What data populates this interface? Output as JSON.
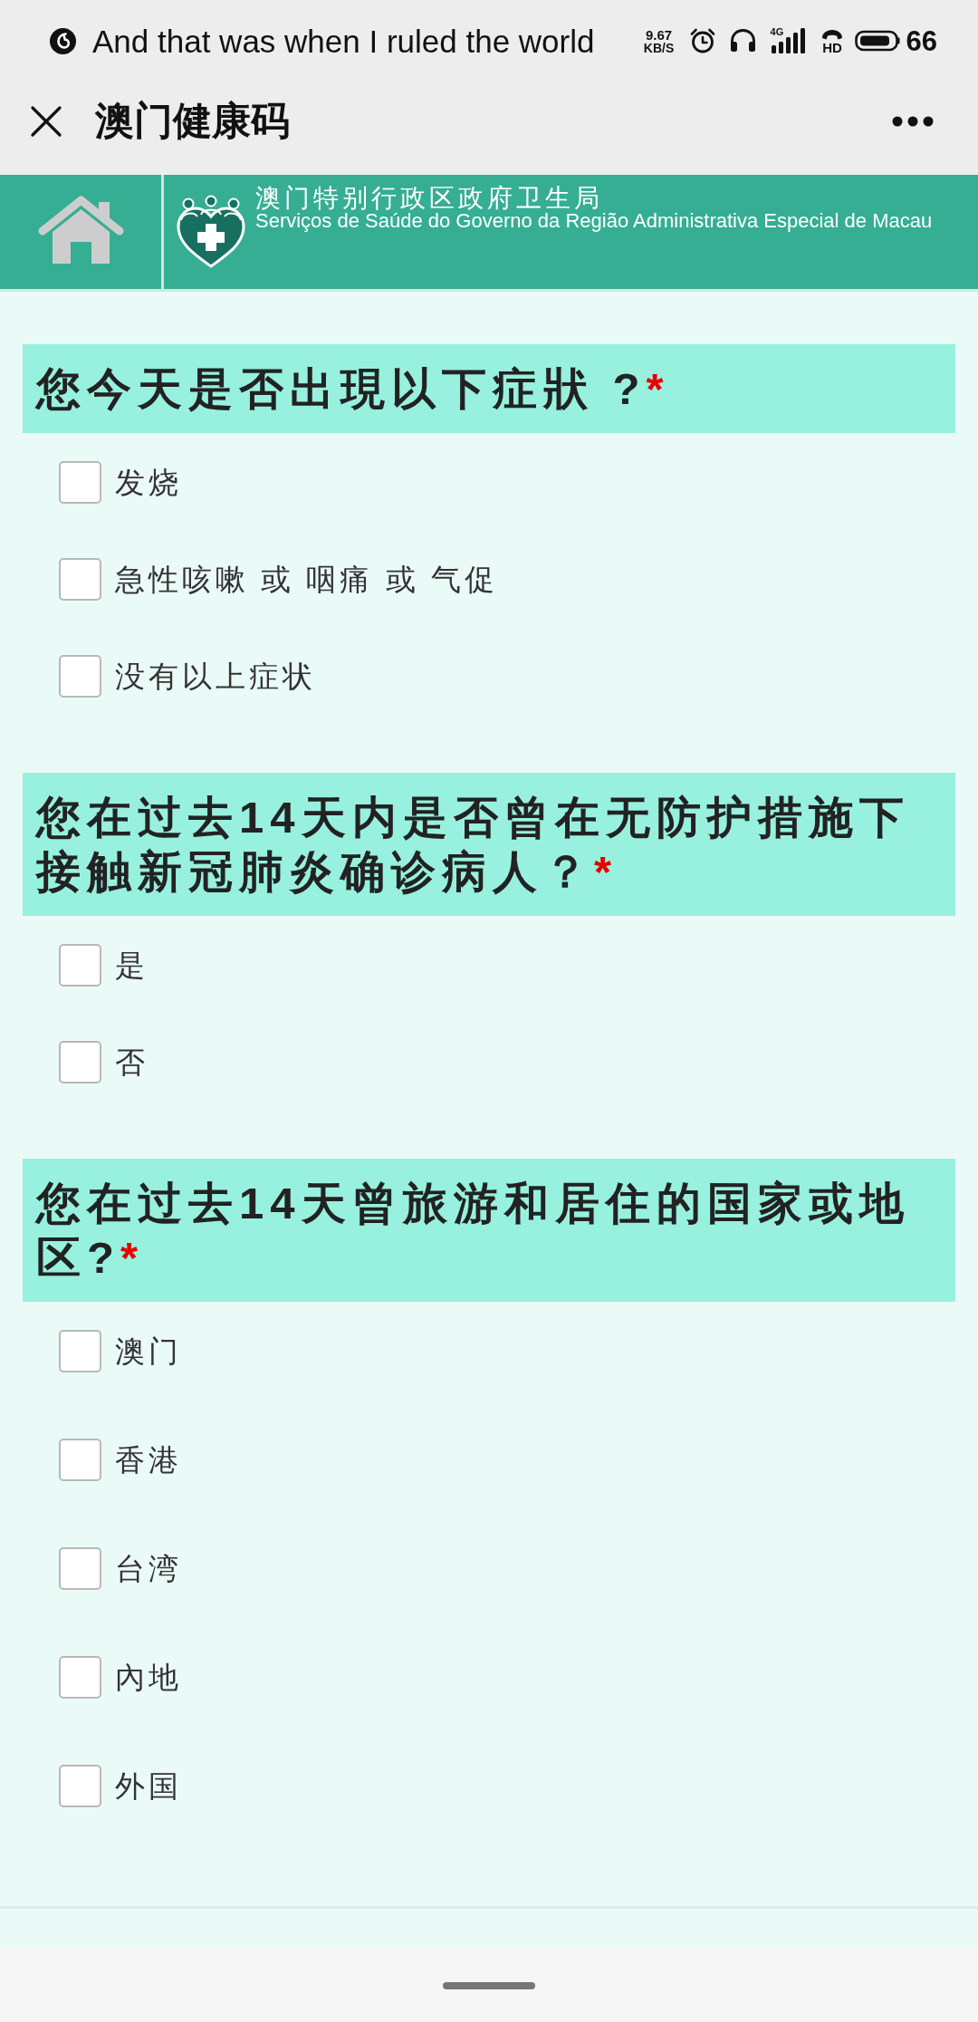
{
  "status_bar": {
    "now_playing": "And that was when I ruled the world",
    "net_speed": "9.67",
    "net_speed_unit": "KB/S",
    "network_type": "4G",
    "call_label": "HD",
    "battery": "66"
  },
  "app_bar": {
    "title": "澳门健康码"
  },
  "banner": {
    "title": "澳门特别行政区政府卫生局",
    "subtitle": "Serviços de Saúde do Governo da Região Administrativa Especial de Macau"
  },
  "questions": [
    {
      "title": "您今天是否出現以下症狀 ?",
      "required_mark": "*",
      "options": [
        {
          "label": "发烧",
          "checked": false
        },
        {
          "label": "急性咳嗽 或 咽痛 或 气促",
          "checked": false
        },
        {
          "label": "没有以上症状",
          "checked": false
        }
      ]
    },
    {
      "title": "您在过去14天内是否曾在无防护措施下接触新冠肺炎确诊病人？",
      "required_mark": "*",
      "options": [
        {
          "label": "是",
          "checked": false
        },
        {
          "label": "否",
          "checked": false
        }
      ]
    },
    {
      "title": "您在过去14天曾旅游和居住的国家或地区?",
      "required_mark": "*",
      "options": [
        {
          "label": "澳门",
          "checked": false
        },
        {
          "label": "香港",
          "checked": false
        },
        {
          "label": "台湾",
          "checked": false
        },
        {
          "label": "內地",
          "checked": false
        },
        {
          "label": "外国",
          "checked": false
        }
      ]
    }
  ]
}
